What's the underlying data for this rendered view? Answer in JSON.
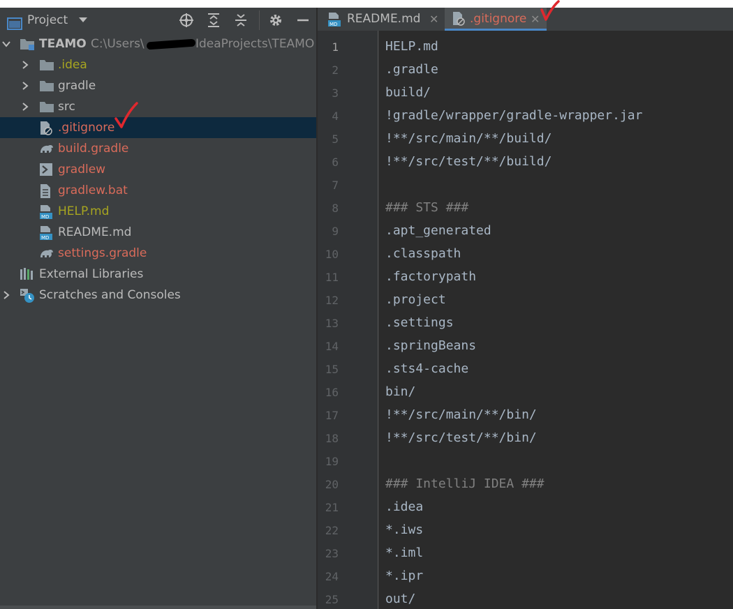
{
  "project_panel": {
    "title": "Project",
    "toolbar_icons": [
      "locate-icon",
      "expand-all-icon",
      "collapse-all-icon",
      "gear-icon",
      "minimize-icon"
    ],
    "root": {
      "name": "TEAMO",
      "path_before": "C:\\Users\\",
      "path_after": "IdeaProjects\\TEAMO"
    },
    "items": [
      {
        "label": ".idea",
        "kind": "folder",
        "expandable": true,
        "color": "#a7a520"
      },
      {
        "label": "gradle",
        "kind": "folder",
        "expandable": true,
        "color": "#bbbbbb"
      },
      {
        "label": "src",
        "kind": "folder",
        "expandable": true,
        "color": "#bbbbbb"
      },
      {
        "label": ".gitignore",
        "kind": "ignore-file",
        "expandable": false,
        "color": "#d96b5a",
        "selected": true
      },
      {
        "label": "build.gradle",
        "kind": "gradle-file",
        "expandable": false,
        "color": "#d96b5a"
      },
      {
        "label": "gradlew",
        "kind": "shell-file",
        "expandable": false,
        "color": "#d96b5a"
      },
      {
        "label": "gradlew.bat",
        "kind": "text-file",
        "expandable": false,
        "color": "#d96b5a"
      },
      {
        "label": "HELP.md",
        "kind": "markdown-file",
        "expandable": false,
        "color": "#a7a520"
      },
      {
        "label": "README.md",
        "kind": "markdown-file",
        "expandable": false,
        "color": "#bbbbbb"
      },
      {
        "label": "settings.gradle",
        "kind": "gradle-file",
        "expandable": false,
        "color": "#d96b5a"
      }
    ],
    "external_libraries": "External Libraries",
    "scratches": "Scratches and Consoles"
  },
  "tabs": [
    {
      "label": "README.md",
      "icon": "markdown-file-icon",
      "active": false
    },
    {
      "label": ".gitignore",
      "icon": "ignore-file-icon",
      "active": true
    }
  ],
  "editor": {
    "current_line": 1,
    "lines": [
      "HELP.md",
      ".gradle",
      "build/",
      "!gradle/wrapper/gradle-wrapper.jar",
      "!**/src/main/**/build/",
      "!**/src/test/**/build/",
      "",
      "### STS ###",
      ".apt_generated",
      ".classpath",
      ".factorypath",
      ".project",
      ".settings",
      ".springBeans",
      ".sts4-cache",
      "bin/",
      "!**/src/main/**/bin/",
      "!**/src/test/**/bin/",
      "",
      "### IntelliJ IDEA ###",
      ".idea",
      "*.iws",
      "*.iml",
      "*.ipr",
      "out/"
    ]
  },
  "colors": {
    "panel_bg": "#3c3f41",
    "editor_bg": "#2b2b2b",
    "modified_red": "#d96b5a",
    "ignored_olive": "#a7a520",
    "selection": "#0d293e",
    "annotation_red": "#e0282e"
  }
}
